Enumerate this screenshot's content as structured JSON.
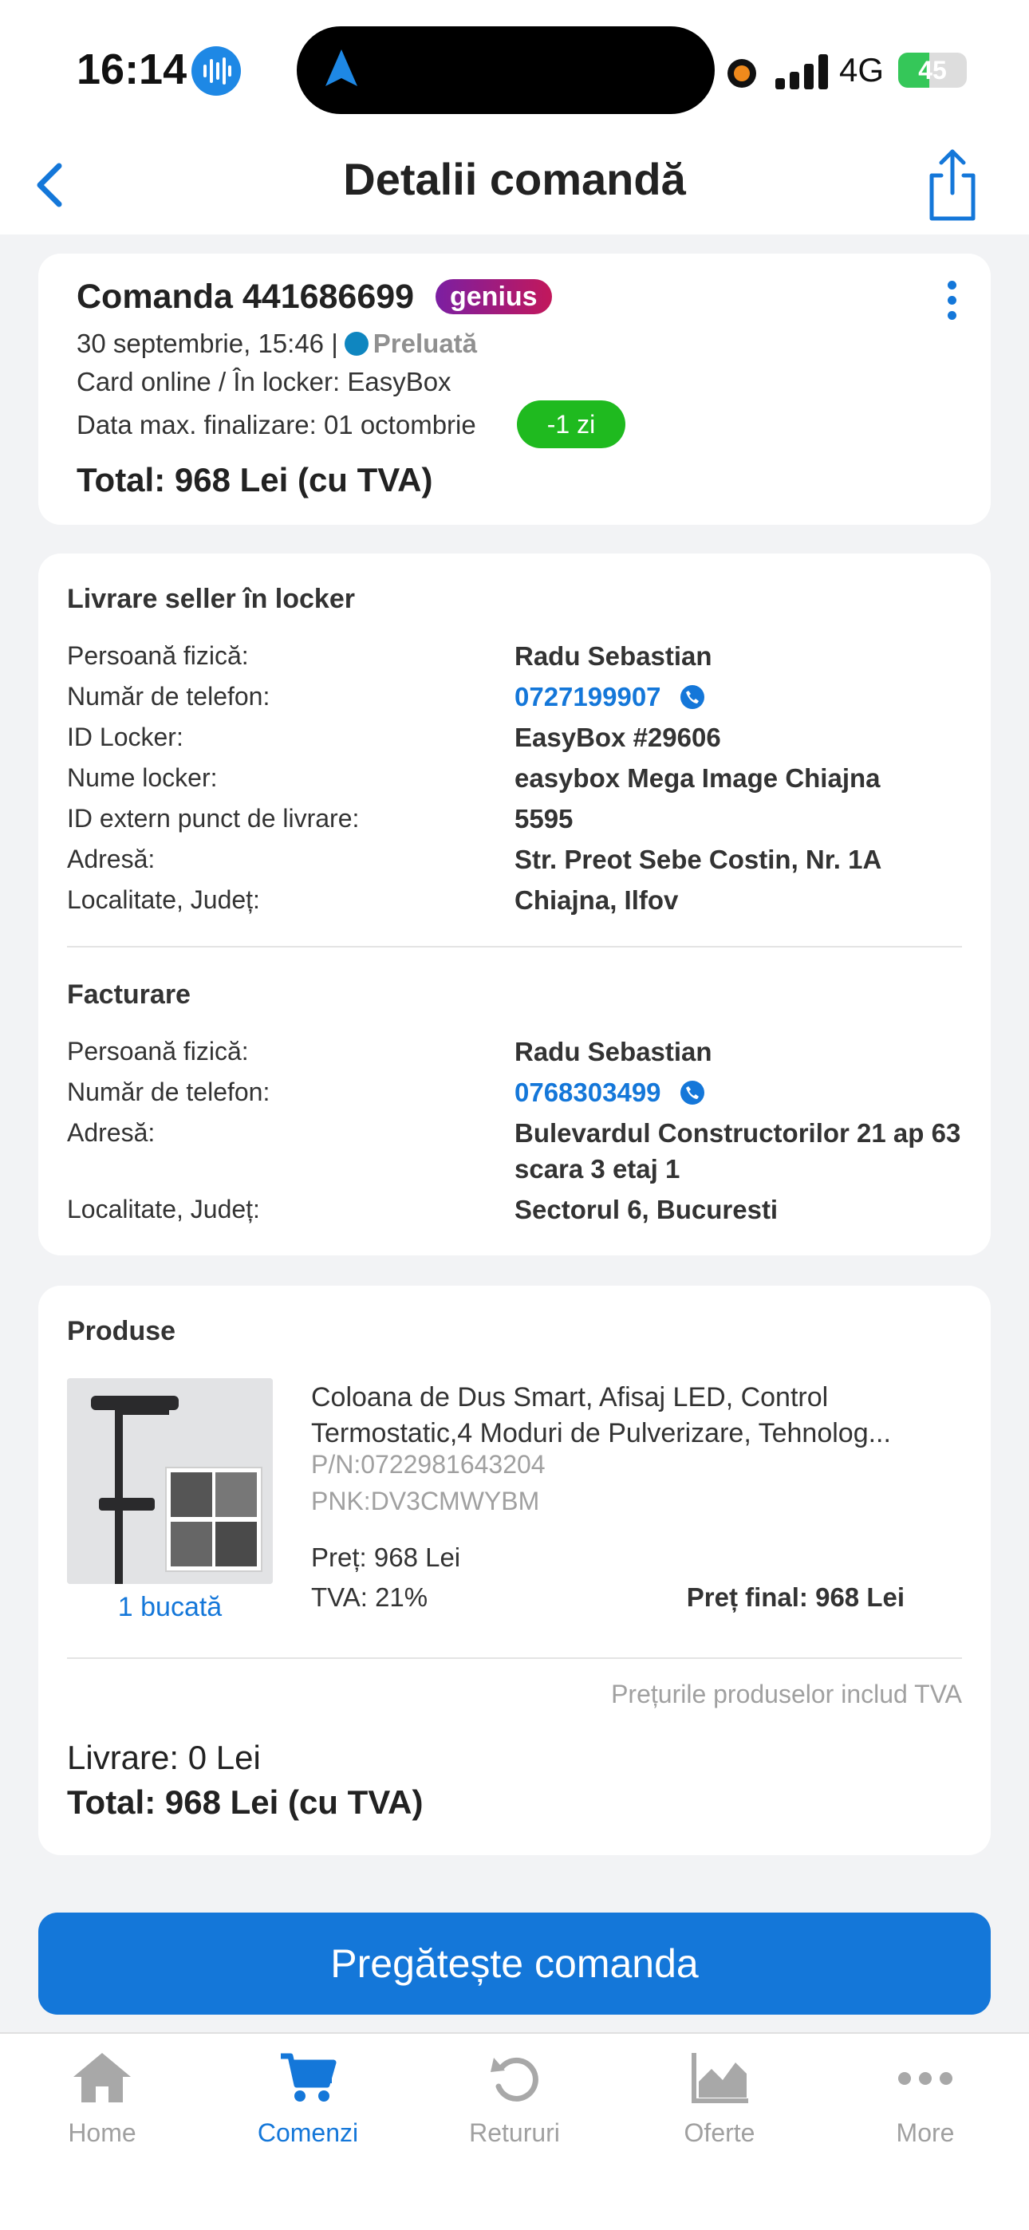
{
  "status_bar": {
    "time": "16:14",
    "network": "4G",
    "battery": "45",
    "battery_level": 0.45
  },
  "header": {
    "title": "Detalii comandă"
  },
  "order": {
    "title": "Comanda 441686699",
    "badge": "genius",
    "datetime": "30 septembrie, 15:46  |",
    "status": "Preluată",
    "payment": "Card online / În locker: EasyBox",
    "deadline": "Data max. finalizare: 01 octombrie",
    "deadline_badge": "-1 zi",
    "total": "Total: 968 Lei (cu TVA)"
  },
  "delivery": {
    "title": "Livrare seller în locker",
    "rows": [
      {
        "label": "Persoană fizică:",
        "value": "Radu Sebastian"
      },
      {
        "label": "Număr de telefon:",
        "value": "0727199907"
      },
      {
        "label": "ID Locker:",
        "value": "EasyBox #29606"
      },
      {
        "label": "Nume locker:",
        "value": "easybox Mega Image Chiajna"
      },
      {
        "label": "ID extern punct de livrare:",
        "value": "5595"
      },
      {
        "label": "Adresă:",
        "value": "Str. Preot Sebe Costin, Nr. 1A"
      },
      {
        "label": "Localitate, Județ:",
        "value": "Chiajna, Ilfov"
      }
    ]
  },
  "billing": {
    "title": "Facturare",
    "rows": [
      {
        "label": "Persoană fizică:",
        "value": "Radu Sebastian"
      },
      {
        "label": "Număr de telefon:",
        "value": "0768303499"
      },
      {
        "label": "Adresă:",
        "value": "Bulevardul Constructorilor 21 ap 63 scara 3 etaj 1"
      },
      {
        "label": "Localitate, Județ:",
        "value": "Sectorul 6, Bucuresti"
      }
    ]
  },
  "products": {
    "title": "Produse",
    "item": {
      "name": "Coloana de Dus Smart, Afisaj LED, Control Termostatic,4 Moduri de Pulverizare, Tehnolog...",
      "pn": "P/N:0722981643204",
      "pnk": "PNK:DV3CMWYBM",
      "quantity": "1 bucată",
      "price": "Preț: 968 Lei",
      "vat": "TVA: 21%",
      "final_price": "Preț final: 968 Lei"
    },
    "vat_note": "Prețurile produselor includ TVA",
    "delivery": "Livrare: 0 Lei",
    "total": "Total: 968 Lei (cu TVA)"
  },
  "cta": {
    "label": "Pregătește comanda"
  },
  "tabs": [
    {
      "label": "Home",
      "icon": "home-icon"
    },
    {
      "label": "Comenzi",
      "icon": "cart-icon",
      "active": true
    },
    {
      "label": "Retururi",
      "icon": "return-icon"
    },
    {
      "label": "Oferte",
      "icon": "chart-icon"
    },
    {
      "label": "More",
      "icon": "more-icon"
    }
  ],
  "colors": {
    "accent": "#1477d9",
    "success": "#1fba1f",
    "genius": "#7b1fa2"
  }
}
